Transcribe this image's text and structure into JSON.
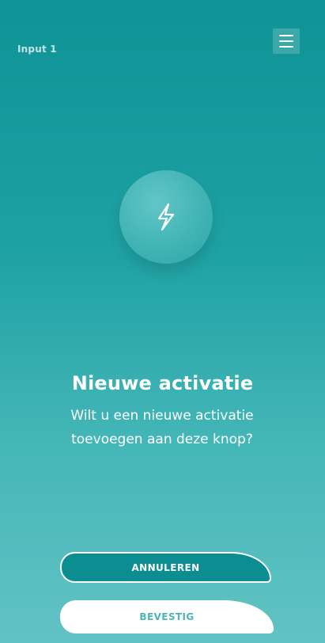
{
  "header": {
    "title": "Input 1",
    "menu_icon": "hamburger-menu-icon"
  },
  "hero": {
    "icon": "lightning-bolt-icon",
    "title": "Nieuwe activatie",
    "message": "Wilt u een nieuwe activatie toevoegen aan deze knop?"
  },
  "actions": {
    "cancel_label": "ANNULEREN",
    "confirm_label": "BEVESTIG"
  },
  "colors": {
    "primary": "#0e9396",
    "gradient_end": "#62c2c3",
    "button_white": "#ffffff"
  }
}
